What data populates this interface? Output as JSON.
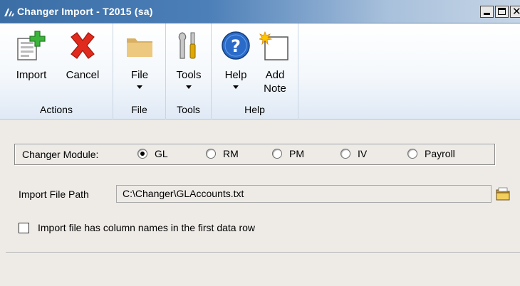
{
  "window": {
    "title": "Changer Import  -  T2015 (sa)",
    "buttons": [
      "minimize-icon",
      "maximize-icon",
      "close-icon"
    ]
  },
  "ribbon": {
    "groups": [
      {
        "label": "Actions",
        "buttons": [
          {
            "label": "Import",
            "icon": "import-icon"
          },
          {
            "label": "Cancel",
            "icon": "cancel-icon"
          }
        ]
      },
      {
        "label": "File",
        "buttons": [
          {
            "label": "File",
            "icon": "folder-icon",
            "dropdown": true
          }
        ]
      },
      {
        "label": "Tools",
        "buttons": [
          {
            "label": "Tools",
            "icon": "tools-icon",
            "dropdown": true
          }
        ]
      },
      {
        "label": "Help",
        "buttons": [
          {
            "label": "Help",
            "icon": "help-icon",
            "dropdown": true
          },
          {
            "label": "Add",
            "label2": "Note",
            "icon": "note-icon"
          }
        ]
      }
    ]
  },
  "form": {
    "module": {
      "label": "Changer Module:",
      "options": [
        "GL",
        "RM",
        "PM",
        "IV",
        "Payroll"
      ],
      "selected": "GL"
    },
    "import_path": {
      "label": "Import File Path",
      "value": "C:\\Changer\\GLAccounts.txt",
      "browse_icon": "folder-browse-icon"
    },
    "column_names_checkbox": {
      "label": "Import file has column names in the first data row",
      "checked": false
    }
  },
  "colors": {
    "titlebar": "#3a6ea5",
    "cancel_red": "#e02a1d",
    "import_green": "#3cb43c",
    "help_blue": "#2a6bc9"
  }
}
